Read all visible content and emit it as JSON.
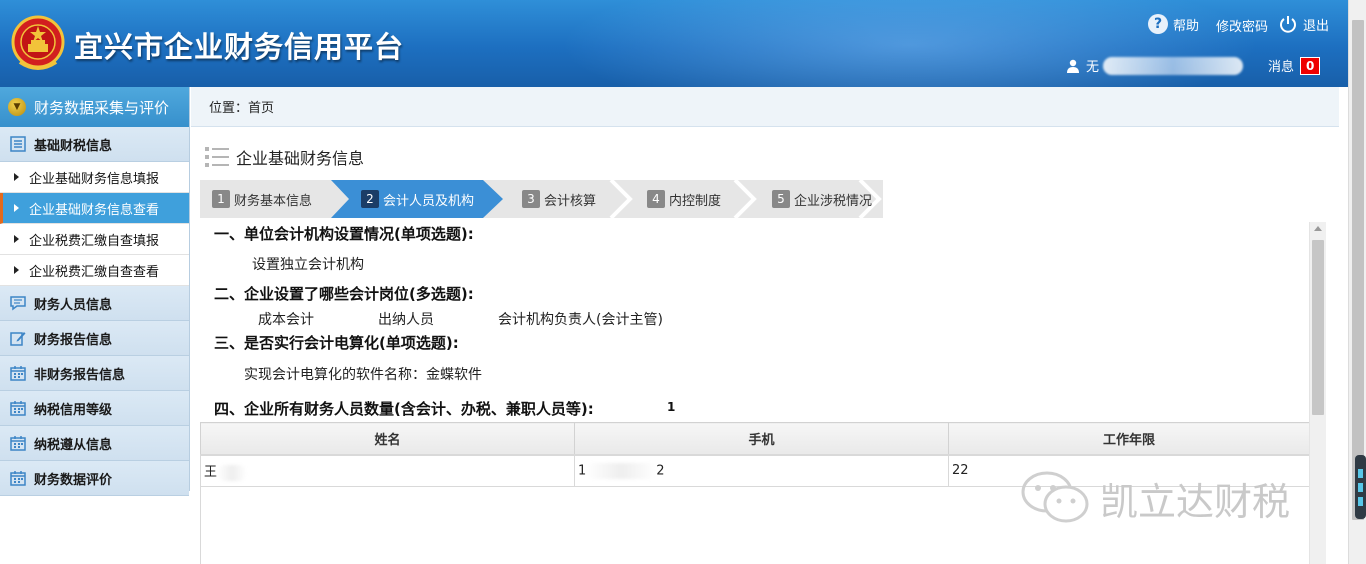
{
  "header": {
    "site_title": "宜兴市企业财务信用平台",
    "help": "帮助",
    "change_password": "修改密码",
    "logout": "退出",
    "user_prefix": "无",
    "messages": "消息",
    "message_count": "0"
  },
  "sidebar": {
    "title": "财务数据采集与评价",
    "sections": [
      {
        "label": "基础财税信息",
        "icon": "list-icon"
      },
      {
        "label": "财务人员信息",
        "icon": "chat-icon"
      },
      {
        "label": "财务报告信息",
        "icon": "edit-icon"
      },
      {
        "label": "非财务报告信息",
        "icon": "calendar-icon"
      },
      {
        "label": "纳税信用等级",
        "icon": "calendar-icon"
      },
      {
        "label": "纳税遵从信息",
        "icon": "calendar-icon"
      },
      {
        "label": "财务数据评价",
        "icon": "calendar-icon"
      }
    ],
    "sub_items": [
      "企业基础财务信息填报",
      "企业基础财务信息查看",
      "企业税费汇缴自查填报",
      "企业税费汇缴自查查看"
    ]
  },
  "breadcrumb": "位置：首页",
  "page_title": "企业基础财务信息",
  "steps": [
    {
      "num": "1",
      "label": "财务基本信息"
    },
    {
      "num": "2",
      "label": "会计人员及机构"
    },
    {
      "num": "3",
      "label": "会计核算"
    },
    {
      "num": "4",
      "label": "内控制度"
    },
    {
      "num": "5",
      "label": "企业涉税情况"
    }
  ],
  "questions": {
    "q1_title": "一、单位会计机构设置情况(单项选题):",
    "q1_answer": "设置独立会计机构",
    "q2_title": "二、企业设置了哪些会计岗位(多选题):",
    "q2_answers": [
      "成本会计",
      "出纳人员",
      "会计机构负责人(会计主管)"
    ],
    "q3_title": "三、是否实行会计电算化(单项选题):",
    "q3_answer": "实现会计电算化的软件名称：金蝶软件",
    "q4_title": "四、企业所有财务人员数量(含会计、办税、兼职人员等):",
    "q4_value": "1"
  },
  "table": {
    "headers": [
      "姓名",
      "手机",
      "工作年限"
    ],
    "rows": [
      {
        "name_start": "王",
        "phone_start": "1",
        "phone_end": "2",
        "years": "22"
      }
    ]
  },
  "watermark": "凯立达财税",
  "colors": {
    "header_blue": "#1d6fc0",
    "sidebar_active": "#3fa0dc",
    "step_active": "#3b8fd6",
    "badge_red": "#e00000"
  }
}
